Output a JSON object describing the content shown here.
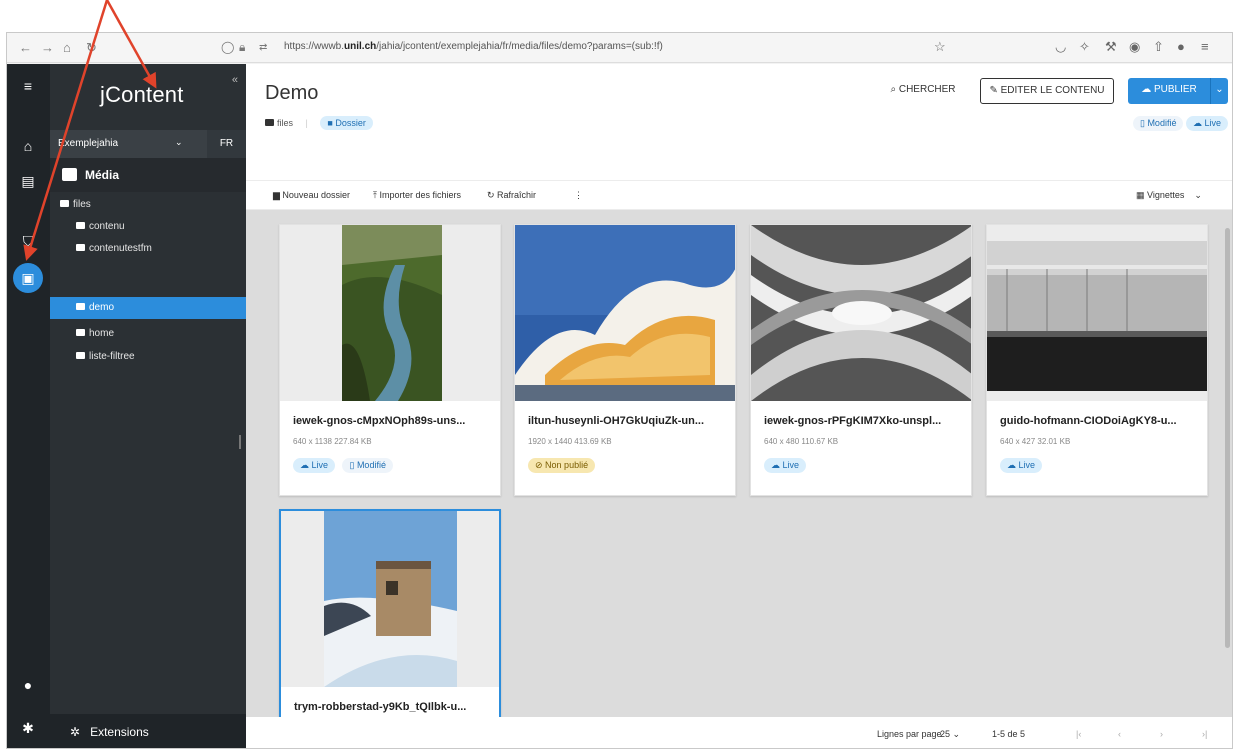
{
  "browser": {
    "url_prefix": "https://wwwb.",
    "url_host": "unil.ch",
    "url_path": "/jahia/jcontent/exemplejahia/fr/media/files/demo?params=(sub:!f)"
  },
  "nav": {
    "logo": "jContent",
    "collapse": "«",
    "site": "Exemplejahia",
    "lang": "FR",
    "section": "Média",
    "tree": [
      {
        "label": "files"
      },
      {
        "label": "contenu"
      },
      {
        "label": "contenutestfm"
      },
      {
        "label": "demo"
      },
      {
        "label": "home"
      },
      {
        "label": "liste-filtree"
      }
    ],
    "extensions": "Extensions"
  },
  "header": {
    "title": "Demo",
    "crumb_root": "files",
    "crumb_type": "Dossier",
    "search": "CHERCHER",
    "edit": "EDITER LE CONTENU",
    "publish": "PUBLIER",
    "status_modified": "Modifié",
    "status_live": "Live"
  },
  "toolbar": {
    "new_folder": "Nouveau dossier",
    "import": "Importer des fichiers",
    "refresh": "Rafraîchir",
    "more": "⋮",
    "view": "Vignettes"
  },
  "cards": [
    {
      "name": "iewek-gnos-cMpxNOph89s-uns...",
      "meta": "640 x 1138  227.84 KB",
      "badges": [
        "Live",
        "Modifié"
      ],
      "thumb": "river-canyon"
    },
    {
      "name": "iltun-huseynli-OH7GkUqiuZk-un...",
      "meta": "1920 x 1440  413.69 KB",
      "badges": [
        "Non publié"
      ],
      "thumb": "curved-building"
    },
    {
      "name": "iewek-gnos-rPFgKIM7Xko-unspl...",
      "meta": "640 x 480  110.67 KB",
      "badges": [
        "Live"
      ],
      "thumb": "spiral-architecture"
    },
    {
      "name": "guido-hofmann-CIODoiAgKY8-u...",
      "meta": "640 x 427  32.01 KB",
      "badges": [
        "Live"
      ],
      "thumb": "glass-pavilion"
    },
    {
      "name": "trym-robberstad-y9Kb_tQIlbk-u...",
      "meta": "",
      "badges": [],
      "thumb": "snow-cabin"
    }
  ],
  "pager": {
    "rows_label": "Lignes par page",
    "rows_value": "25",
    "range": "1-5 de 5"
  },
  "colors": {
    "accent": "#2c8ddc",
    "rail": "#1f2428",
    "panel": "#2b3034",
    "arrow": "#e0432b"
  }
}
